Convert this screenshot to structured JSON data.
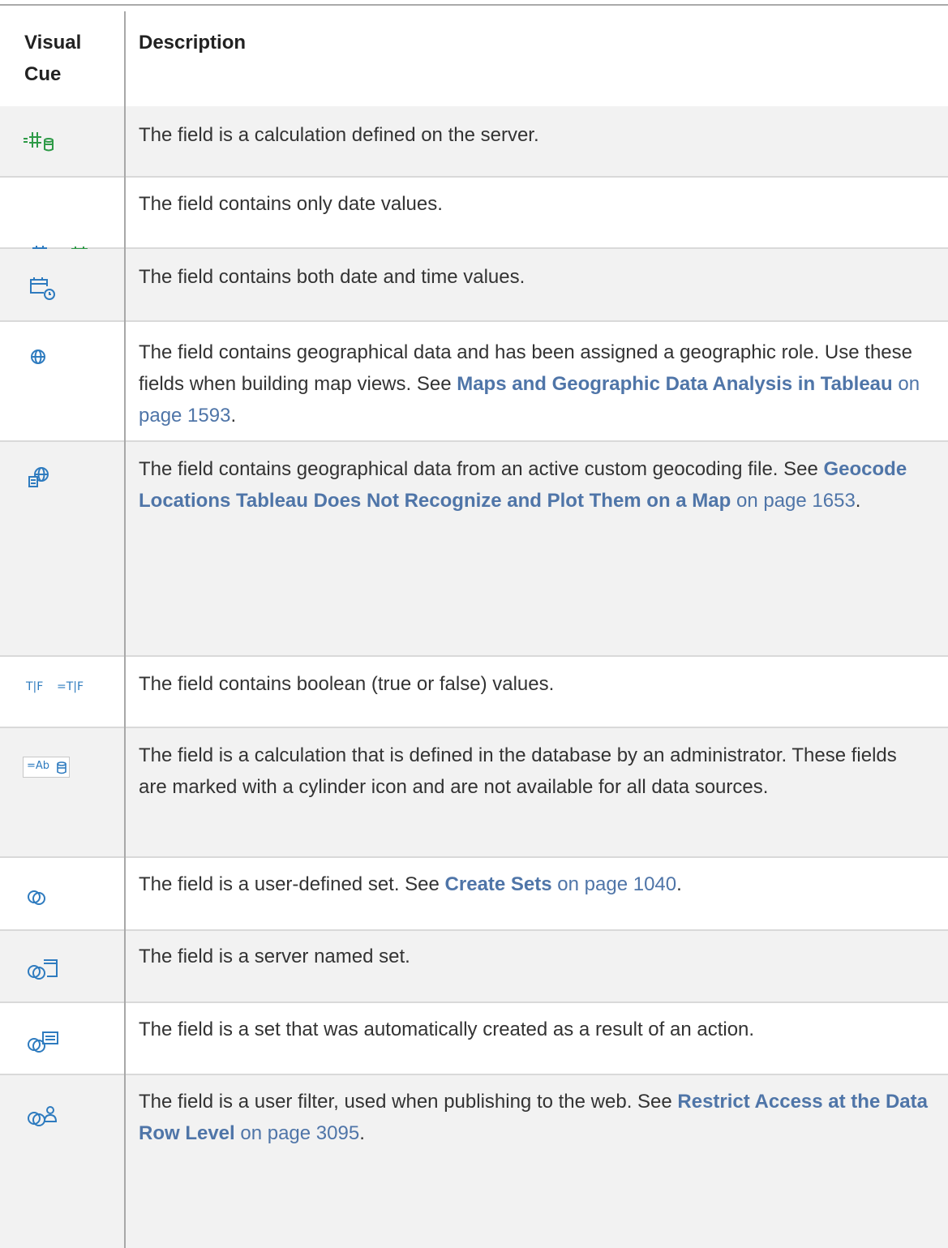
{
  "header": {
    "visual_cue_line1": "Visual",
    "visual_cue_line2": "Cue",
    "description": "Description"
  },
  "rows": [
    {
      "icon": "calculation-server-icon",
      "text": "The field is a calculation defined on the server."
    },
    {
      "icon": "date-icon",
      "text": "The field contains only date values."
    },
    {
      "icon": "date-time-icon",
      "text": "The field contains both date and time values."
    },
    {
      "icon": "globe-icon",
      "text": "The field contains geographical data and has been assigned a geographic role. Use these fields when building map views. See ",
      "link": "Maps and Geographic Data Analysis in Tableau",
      "page": "on page 1593",
      "tail": "."
    },
    {
      "icon": "custom-geocoding-icon",
      "text": "The field contains geographical data from an active custom geocoding file. See ",
      "link": "Geocode Locations Tableau Does Not Recognize and Plot Them on a Map",
      "page": "on page 1653",
      "tail": "."
    },
    {
      "icon": "boolean-icon",
      "glyph_a": "T|F",
      "glyph_b": "=T|F",
      "text": "The field contains boolean (true or false) values."
    },
    {
      "icon": "database-calculation-icon",
      "glyph": "=Ab",
      "text": "The field is a calculation that is defined in the database by an administrator. These fields are marked with a cylinder icon and are not available for all data sources."
    },
    {
      "icon": "set-icon",
      "text": "The field is a user-defined set. See ",
      "link": "Create Sets",
      "page": "on page 1040",
      "tail": "."
    },
    {
      "icon": "server-named-set-icon",
      "text": "The field is a server named set."
    },
    {
      "icon": "action-set-icon",
      "text": "The field is a set that was automatically created as a result of an action."
    },
    {
      "icon": "user-filter-icon",
      "text": "The field is a user filter, used when publishing to the web. See ",
      "link": "Restrict Access at the Data Row Level",
      "page": "on page 3095",
      "tail": "."
    }
  ],
  "colors": {
    "icon_blue": "#2e7bbf",
    "icon_green": "#2e9a47",
    "link": "#4f75a8",
    "row_shade": "#f2f2f2"
  }
}
